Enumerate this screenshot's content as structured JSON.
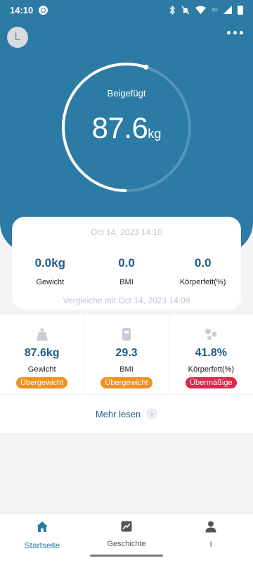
{
  "status": {
    "time": "14:10",
    "network": "4G"
  },
  "user": {
    "avatar_letter": "L"
  },
  "gauge": {
    "label": "Beigefügt",
    "value": "87.6",
    "unit": "kg",
    "progress": 0.55
  },
  "comparison_card": {
    "timestamp": "Oct 14, 2023 14:10",
    "items": [
      {
        "value": "0.0kg",
        "label": "Gewicht"
      },
      {
        "value": "0.0",
        "label": "BMI"
      },
      {
        "value": "0.0",
        "label": "Körperfett(%)"
      }
    ],
    "compare_text": "Vergleiche mit Oct 14, 2023 14:09"
  },
  "metrics": [
    {
      "icon": "weight-icon",
      "value": "87.6kg",
      "label": "Gewicht",
      "badge": "Übergewicht",
      "badge_color": "#f0901f"
    },
    {
      "icon": "bmi-icon",
      "value": "29.3",
      "label": "BMI",
      "badge": "Übergewicht",
      "badge_color": "#f0901f"
    },
    {
      "icon": "body-fat-icon",
      "value": "41.8%",
      "label": "Körperfett(%)",
      "badge": "Übermäßige",
      "badge_color": "#d9294c"
    }
  ],
  "more_link": "Mehr lesen",
  "nav": [
    {
      "label": "Startseite",
      "icon": "home-icon",
      "active": true
    },
    {
      "label": "Geschichte",
      "icon": "chart-icon",
      "active": false
    },
    {
      "label": "I",
      "icon": "person-icon",
      "active": false
    }
  ],
  "colors": {
    "primary": "#2b7ba5",
    "value_text": "#1f5c86",
    "overweight": "#f0901f",
    "excessive": "#d9294c"
  }
}
